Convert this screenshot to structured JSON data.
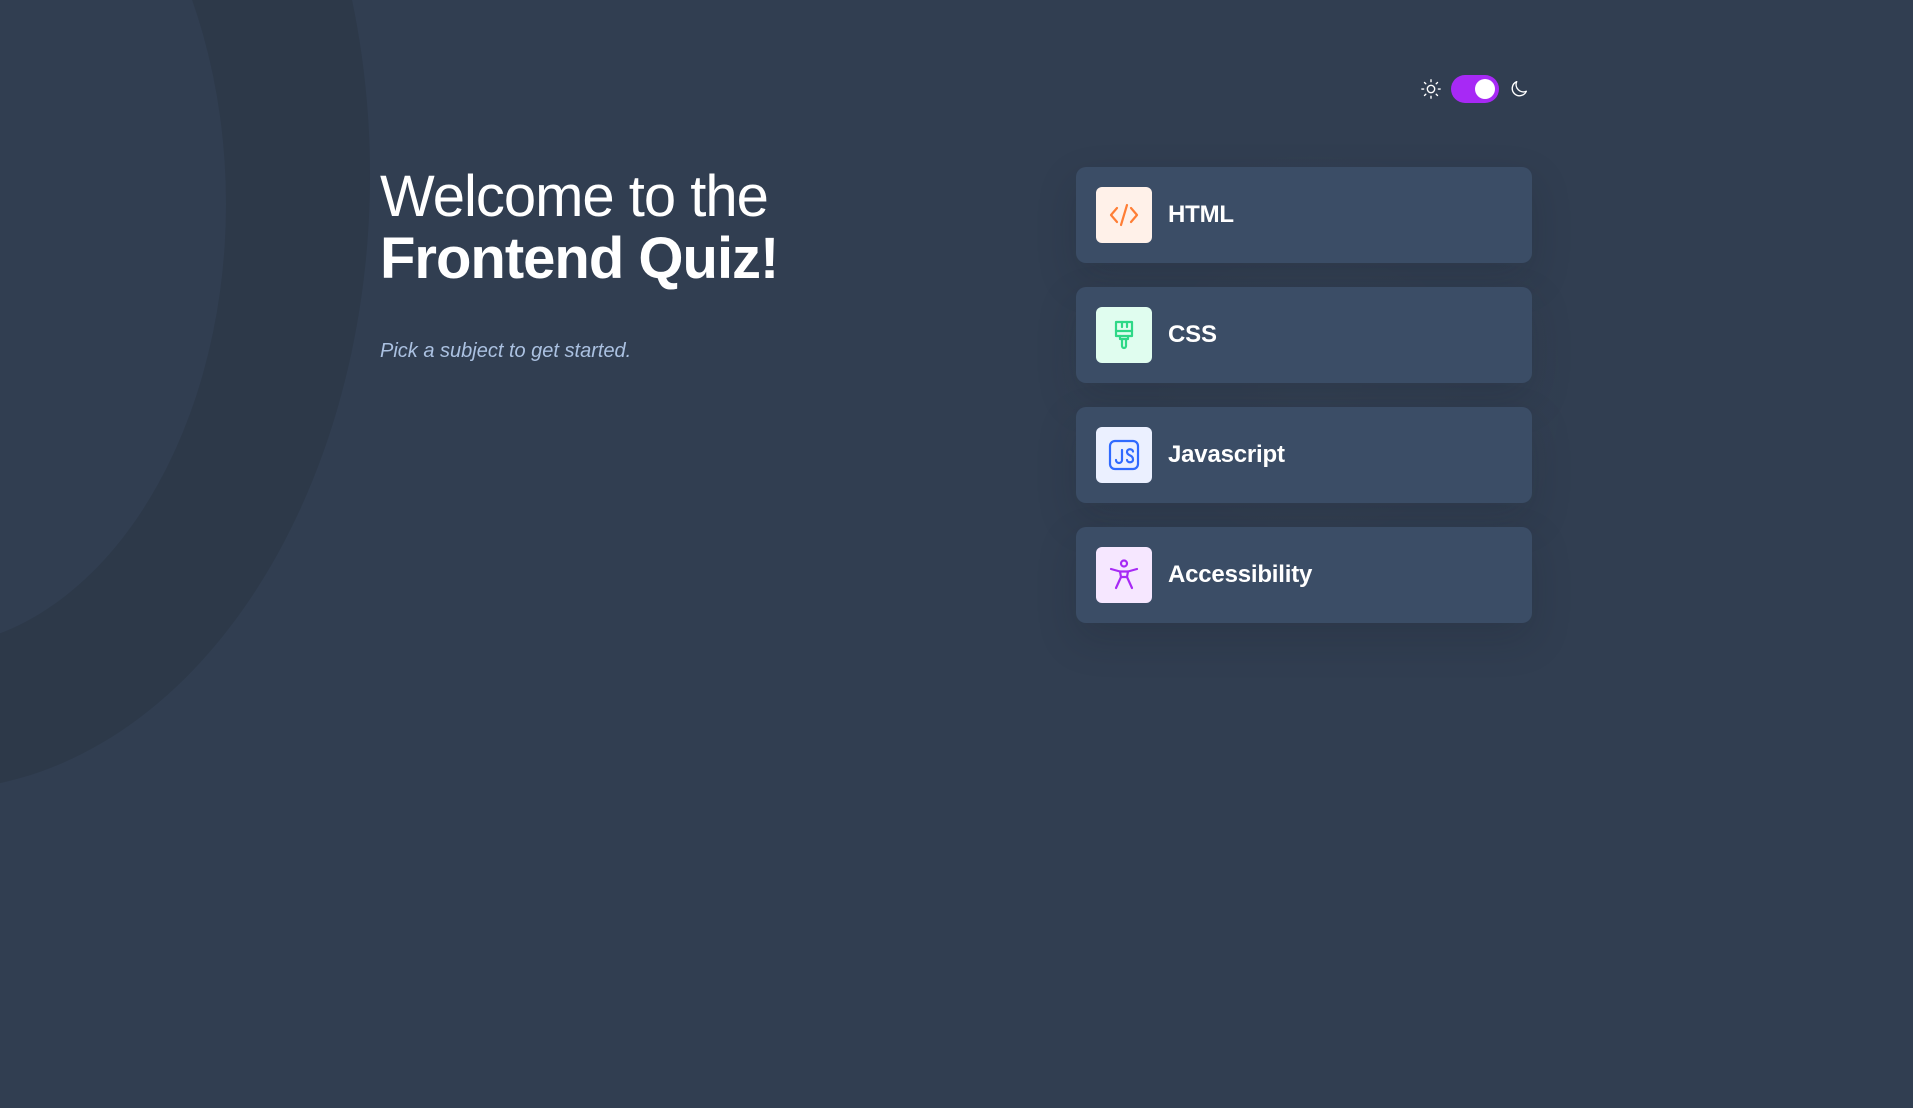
{
  "theme": {
    "mode": "dark",
    "light_icon": "sun-icon",
    "dark_icon": "moon-icon",
    "toggle_on": true,
    "accent": "#a729f5",
    "background": "#313e51",
    "card_background": "#3b4d66"
  },
  "intro": {
    "title_line1": "Welcome to the",
    "title_line2": "Frontend Quiz!",
    "subtitle": "Pick a subject to get started."
  },
  "subjects": [
    {
      "label": "HTML",
      "icon": "html-code-icon",
      "icon_bg": "#fff1e9",
      "icon_color": "#ff7e35"
    },
    {
      "label": "CSS",
      "icon": "css-brush-icon",
      "icon_bg": "#e0fdef",
      "icon_color": "#2fd887"
    },
    {
      "label": "Javascript",
      "icon": "javascript-icon",
      "icon_bg": "#ebf0ff",
      "icon_color": "#306aff"
    },
    {
      "label": "Accessibility",
      "icon": "accessibility-icon",
      "icon_bg": "#f6e7ff",
      "icon_color": "#a729f5"
    }
  ]
}
